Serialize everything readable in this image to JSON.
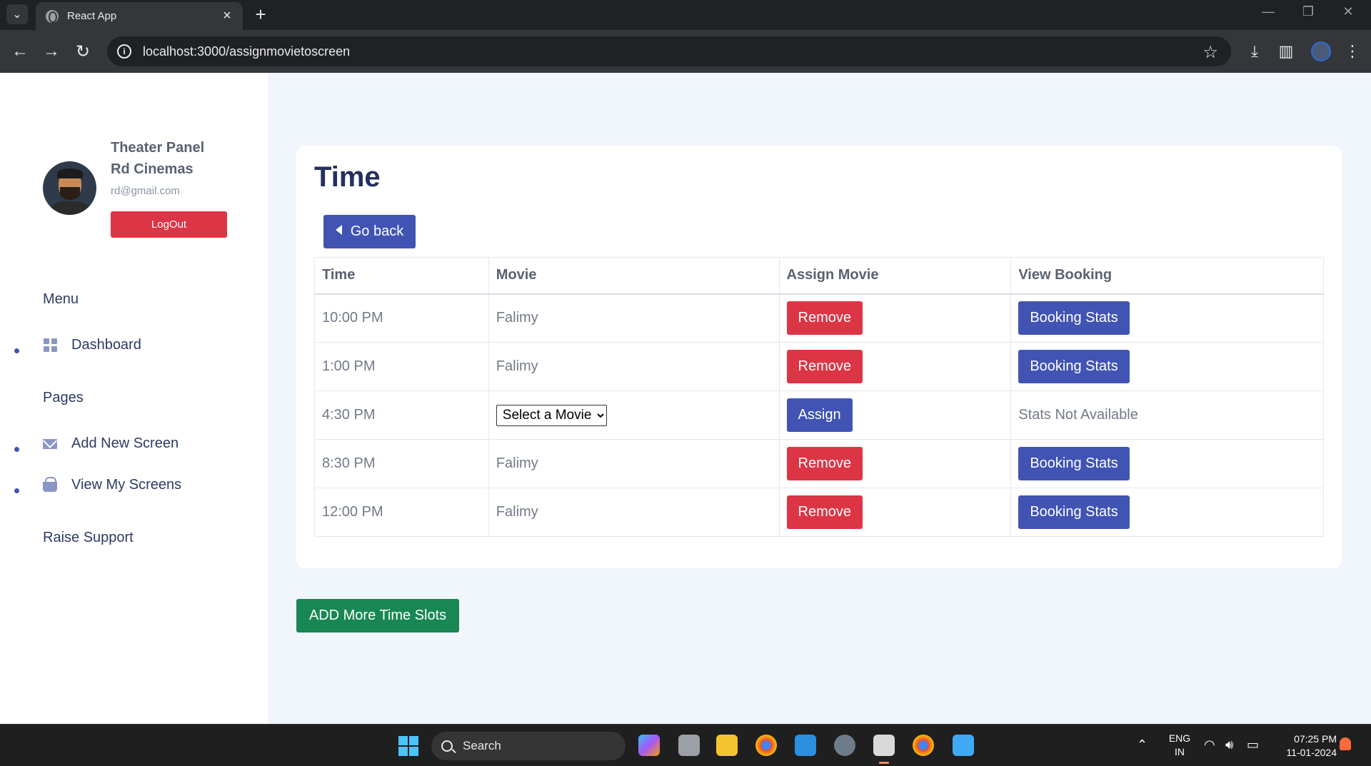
{
  "browser": {
    "tab_title": "React App",
    "url": "localhost:3000/assignmovietoscreen"
  },
  "sidebar": {
    "panel_title": "Theater Panel",
    "cinema_name": "Rd Cinemas",
    "email": "rd@gmail.com",
    "logout_label": "LogOut",
    "menu_heading": "Menu",
    "dashboard_label": "Dashboard",
    "pages_heading": "Pages",
    "add_screen_label": "Add New Screen",
    "view_screens_label": "View My Screens",
    "support_label": "Raise Support"
  },
  "main": {
    "title": "Time",
    "go_back_label": "Go back",
    "headers": {
      "time": "Time",
      "movie": "Movie",
      "assign": "Assign Movie",
      "booking": "View Booking"
    },
    "rows": [
      {
        "time": "10:00 PM",
        "movie": "Falimy",
        "action": "Remove",
        "booking": "Booking Stats"
      },
      {
        "time": "1:00 PM",
        "movie": "Falimy",
        "action": "Remove",
        "booking": "Booking Stats"
      },
      {
        "time": "4:30 PM",
        "movie_select": "Select a Movie",
        "action": "Assign",
        "booking": "Stats Not Available"
      },
      {
        "time": "8:30 PM",
        "movie": "Falimy",
        "action": "Remove",
        "booking": "Booking Stats"
      },
      {
        "time": "12:00 PM",
        "movie": "Falimy",
        "action": "Remove",
        "booking": "Booking Stats"
      }
    ],
    "add_slots_label": "ADD More Time Slots"
  },
  "taskbar": {
    "search_label": "Search",
    "lang_line1": "ENG",
    "lang_line2": "IN",
    "time": "07:25 PM",
    "date": "11-01-2024"
  },
  "colors": {
    "primary": "#4154b3",
    "danger": "#dc3545",
    "success": "#198754",
    "heading": "#24305e",
    "page_bg": "#f1f5fc"
  }
}
